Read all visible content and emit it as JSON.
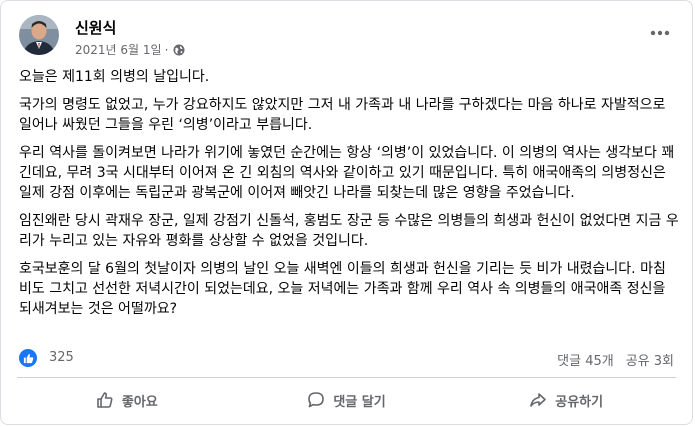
{
  "post": {
    "author": "신원식",
    "date": "2021년 6월 1일",
    "audience_icon": "globe-icon",
    "more_icon": "more-icon",
    "paragraphs": [
      "오늘은 제11회 의병의 날입니다.",
      "  국가의 명령도 없었고, 누가 강요하지도 않았지만 그저 내 가족과 내 나라를 구하겠다는 마음 하나로 자발적으로 일어나 싸웠던 그들을 우린 ‘의병’이라고 부릅니다.",
      "  우리 역사를 돌이켜보면 나라가 위기에 놓였던 순간에는 항상 ‘의병’이 있었습니다. 이 의병의 역사는 생각보다 꽤 긴데요, 무려 3국 시대부터 이어져 온 긴 외침의 역사와 같이하고 있기 때문입니다. 특히 애국애족의 의병정신은 일제 강점 이후에는 독립군과 광복군에 이어져 빼앗긴 나라를 되찾는데 많은 영향을 주었습니다.",
      "  임진왜란 당시 곽재우 장군, 일제 강점기 신돌석, 홍범도 장군 등 수많은 의병들의 희생과 헌신이 없었다면 지금 우리가 누리고 있는 자유와 평화를 상상할 수 없었을 것입니다.",
      "  호국보훈의 달 6월의 첫날이자 의병의 날인 오늘 새벽엔 이들의 희생과 헌신을 기리는 듯 비가 내렸습니다. 마침 비도 그치고 선선한 저녁시간이 되었는데요, 오늘 저녁에는 가족과 함께 우리 역사 속 의병들의 애국애족 정신을 되새겨보는 것은 어떨까요?"
    ]
  },
  "stats": {
    "reactions": "325",
    "comments": "댓글 45개",
    "shares": "공유 3회"
  },
  "actions": {
    "like": "좋아요",
    "comment": "댓글 달기",
    "share": "공유하기"
  },
  "colors": {
    "accent": "#1877f2",
    "secondary_text": "#65676b",
    "divider": "#ced0d4"
  }
}
